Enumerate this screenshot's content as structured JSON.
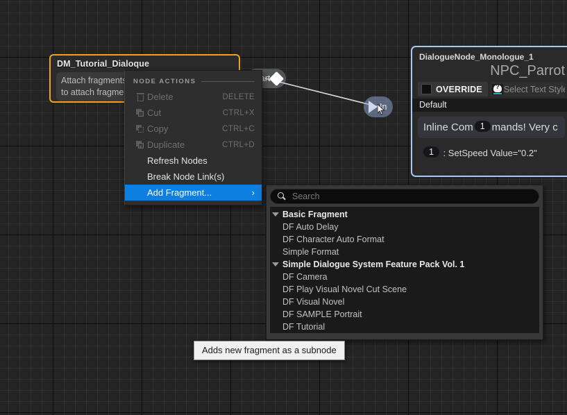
{
  "canvas": {
    "background_color": "#242424",
    "grid_minor_color": "#303030",
    "grid_major_color": "#0a0a0a"
  },
  "root_node": {
    "title": "DM_Tutorial_Dialoque",
    "body_line_1": "Attach fragments",
    "body_line_2": "to attach fragmer",
    "border_color": "#f2a319",
    "output_pin_label": "Start"
  },
  "monologue_node": {
    "title": "DialogueNode_Monologue_1",
    "speaker": "NPC_Parrot",
    "input_pin_label": "In",
    "override_label": "OVERRIDE",
    "style_picker_text": "Select Text Style T",
    "default_row": "Default",
    "text_before_pill": "Inline Com",
    "pill_1": "1",
    "text_after_pill": "mands! Very c",
    "command_pill": "1",
    "command_text": ": SetSpeed Value=\"0.2\"",
    "border_color": "#a9c9ec"
  },
  "context_menu": {
    "section_label": "NODE ACTIONS",
    "highlight_color": "#0d7fe0",
    "items": [
      {
        "label": "Delete",
        "shortcut": "DELETE",
        "icon": "trash-icon",
        "disabled": true,
        "submenu": false
      },
      {
        "label": "Cut",
        "shortcut": "CTRL+X",
        "icon": "cut-icon",
        "disabled": true,
        "submenu": false
      },
      {
        "label": "Copy",
        "shortcut": "CTRL+C",
        "icon": "copy-icon",
        "disabled": true,
        "submenu": false
      },
      {
        "label": "Duplicate",
        "shortcut": "CTRL+D",
        "icon": "duplicate-icon",
        "disabled": true,
        "submenu": false
      },
      {
        "label": "Refresh Nodes",
        "shortcut": "",
        "icon": "",
        "disabled": false,
        "submenu": false
      },
      {
        "label": "Break Node Link(s)",
        "shortcut": "",
        "icon": "",
        "disabled": false,
        "submenu": false
      },
      {
        "label": "Add Fragment...",
        "shortcut": "",
        "icon": "",
        "disabled": false,
        "submenu": true,
        "highlighted": true,
        "submenu_arrow": "›"
      }
    ]
  },
  "fragment_panel": {
    "search_placeholder": "Search",
    "search_value": "",
    "groups": [
      {
        "name": "Basic Fragment",
        "items": [
          "DF Auto Delay",
          "DF Character Auto Format",
          "Simple Format"
        ]
      },
      {
        "name": "Simple Dialogue System Feature Pack Vol. 1",
        "items": [
          "DF Camera",
          "DF Play Visual Novel Cut Scene",
          "DF Visual Novel",
          "DF SAMPLE Portrait",
          "DF Tutorial"
        ]
      }
    ]
  },
  "tooltip": {
    "text": "Adds new fragment as a subnode"
  }
}
